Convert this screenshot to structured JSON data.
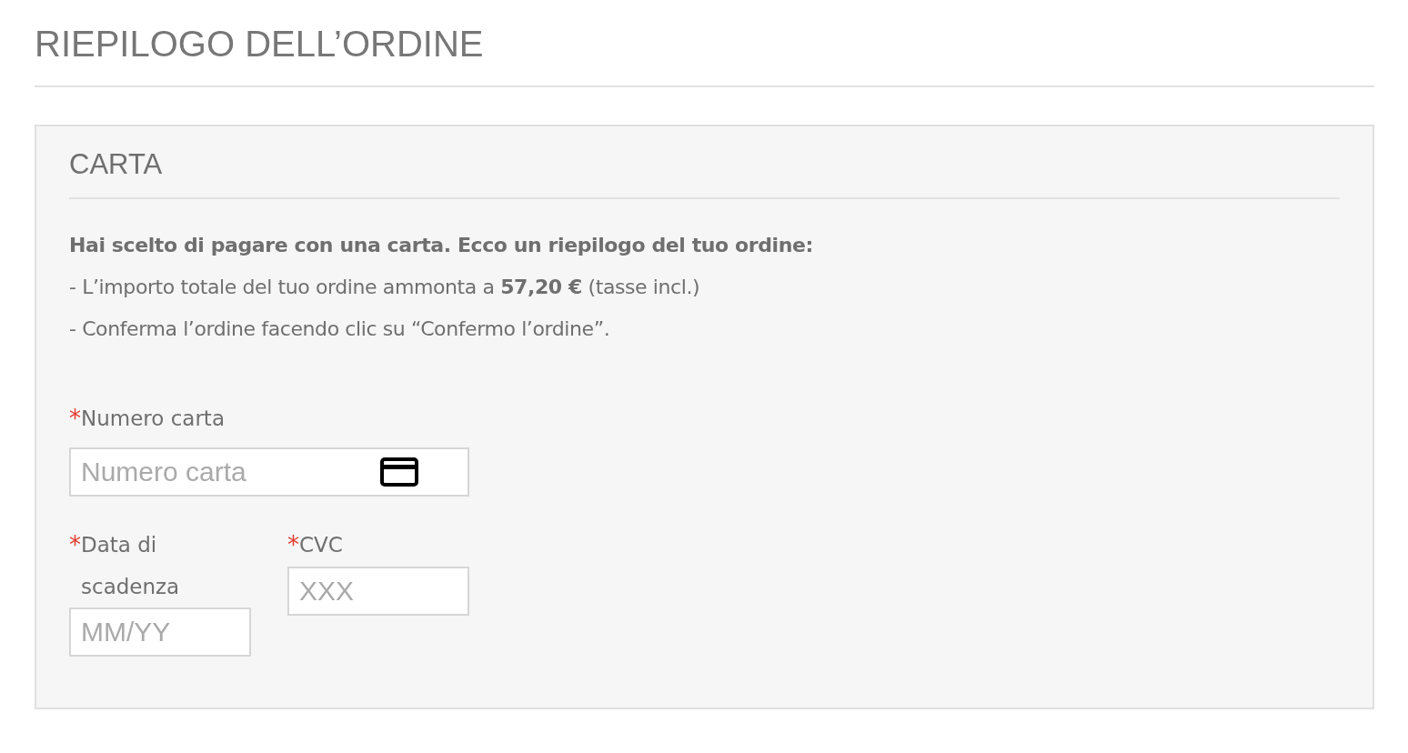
{
  "page_title": "RIEPILOGO DELL’ORDINE",
  "panel": {
    "title": "CARTA",
    "lines": [
      {
        "kind": "lead",
        "text": "Hai scelto di pagare con una carta. Ecco un riepilogo del tuo ordine:"
      },
      {
        "kind": "item",
        "text": "- L’importo totale del tuo ordine ammonta a **57,20 €** (tasse incl.)"
      },
      {
        "kind": "item",
        "text": "- Conferma l’ordine facendo clic su “Confermo l’ordine”."
      }
    ],
    "fields": [
      {
        "kind": "card_number",
        "required_mark": "*",
        "label": "Numero carta",
        "placeholder": "Numero carta"
      },
      {
        "kind": "expiry",
        "required_mark": "*",
        "label": "Data di scadenza",
        "placeholder": "MM/YY"
      },
      {
        "kind": "cvc",
        "required_mark": "*",
        "label": "CVC",
        "placeholder": "XXX"
      }
    ]
  }
}
